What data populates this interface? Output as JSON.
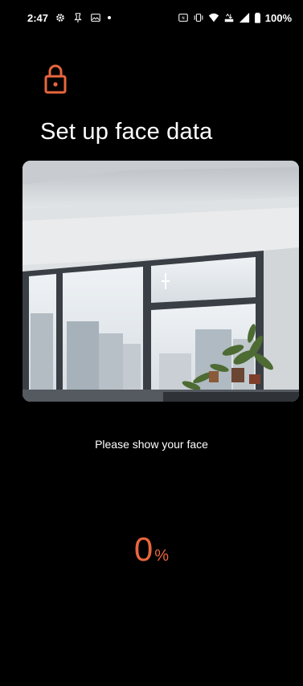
{
  "status_bar": {
    "time": "2:47",
    "battery": "100%",
    "left_icons": [
      "gear-icon",
      "pin-icon",
      "image-icon",
      "dot-icon"
    ],
    "right_icons": [
      "nfc-icon",
      "vibrate-icon",
      "wifi-icon",
      "data-icon",
      "signal-icon",
      "battery-icon"
    ]
  },
  "header": {
    "icon": "lock-icon",
    "title": "Set up face data"
  },
  "camera": {
    "description_icon": "crosshair-icon"
  },
  "instruction": "Please show your face",
  "progress": {
    "value": "0",
    "unit": "%"
  },
  "colors": {
    "accent": "#e8663e",
    "background": "#000000",
    "text": "#ffffff"
  }
}
